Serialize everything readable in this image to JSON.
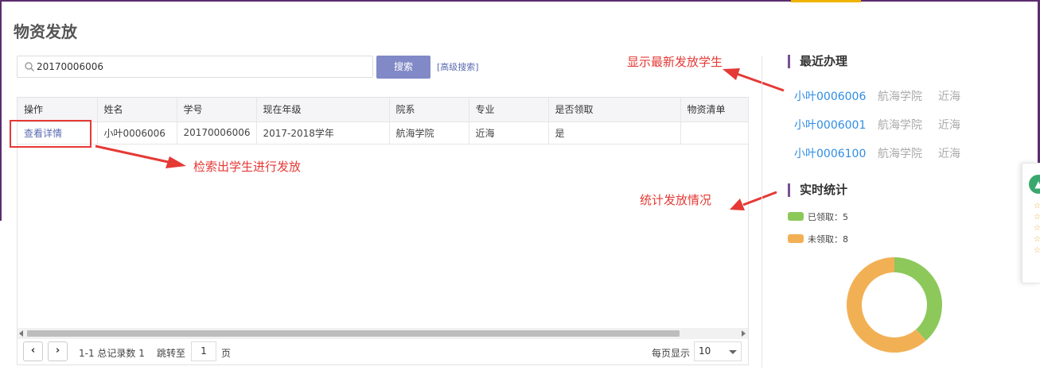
{
  "page": {
    "title": "物资发放"
  },
  "search": {
    "value": "20170006006",
    "button_label": "搜索",
    "advanced_label": "[高级搜索]"
  },
  "table": {
    "headers": [
      "操作",
      "姓名",
      "学号",
      "现在年级",
      "院系",
      "专业",
      "是否领取",
      "物资清单"
    ],
    "rows": [
      {
        "action": "查看详情",
        "name": "小叶0006006",
        "id": "20170006006",
        "grade": "2017-2018学年",
        "dept": "航海学院",
        "major": "近海",
        "received": "是",
        "list": ""
      }
    ]
  },
  "pager": {
    "summary": "1-1 总记录数 1",
    "jump_label": "跳转至",
    "page": "1",
    "page_unit": "页",
    "per_page_label": "每页显示",
    "per_page": "10"
  },
  "annotations": {
    "search_hint": "检索出学生进行发放",
    "recent_hint": "显示最新发放学生",
    "stats_hint": "统计发放情况"
  },
  "recent": {
    "title": "最近办理",
    "items": [
      {
        "name": "小叶0006006",
        "dept": "航海学院",
        "major": "近海"
      },
      {
        "name": "小叶0006001",
        "dept": "航海学院",
        "major": "近海"
      },
      {
        "name": "小叶0006100",
        "dept": "航海学院",
        "major": "近海"
      }
    ]
  },
  "stats": {
    "title": "实时统计",
    "legend": [
      {
        "label": "已领取：5",
        "color": "#8cc85a"
      },
      {
        "label": "未领取：8",
        "color": "#f2b055"
      }
    ]
  },
  "chart_data": {
    "type": "pie",
    "labels": [
      "已领取",
      "未领取"
    ],
    "values": [
      5,
      8
    ],
    "colors": [
      "#8cc85a",
      "#f2b055"
    ],
    "title": "",
    "donut": true
  }
}
